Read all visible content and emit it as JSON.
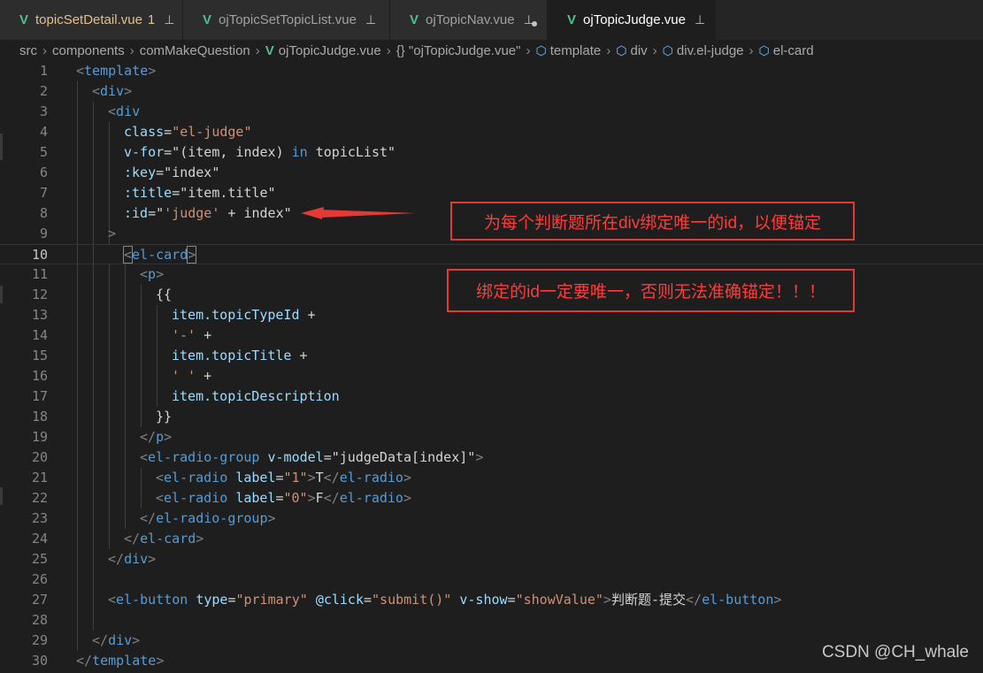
{
  "tabs": [
    {
      "title": "topicSetDetail.vue",
      "badge": "1",
      "modified": true
    },
    {
      "title": "ojTopicSetTopicList.vue"
    },
    {
      "title": "ojTopicNav.vue",
      "unsaved": true
    },
    {
      "title": "ojTopicJudge.vue",
      "active": true
    }
  ],
  "breadcrumb": [
    "src",
    "components",
    "comMakeQuestion",
    "ojTopicJudge.vue",
    "{} \"ojTopicJudge.vue\"",
    "template",
    "div",
    "div.el-judge",
    "el-card"
  ],
  "line_numbers": [
    "1",
    "2",
    "3",
    "4",
    "5",
    "6",
    "7",
    "8",
    "9",
    "10",
    "11",
    "12",
    "13",
    "14",
    "15",
    "16",
    "17",
    "18",
    "19",
    "20",
    "21",
    "22",
    "23",
    "24",
    "25",
    "26",
    "27",
    "28",
    "29",
    "30"
  ],
  "code": {
    "l1": [
      "<",
      "template",
      ">"
    ],
    "l2": [
      "<",
      "div",
      ">"
    ],
    "l3": [
      "<",
      "div"
    ],
    "l4": [
      "class",
      "=",
      "\"el-judge\""
    ],
    "l5": [
      "v-for",
      "=\"(item, index) ",
      "in",
      " topicList\""
    ],
    "l6": [
      ":key",
      "=\"index\""
    ],
    "l7": [
      ":title",
      "=\"item.title\""
    ],
    "l8": [
      ":id",
      "=\"",
      "'judge'",
      " + index\""
    ],
    "l9": [
      ">"
    ],
    "l10": [
      "<",
      "el-card",
      ">"
    ],
    "l11": [
      "<",
      "p",
      ">"
    ],
    "l12": [
      "{{"
    ],
    "l13": [
      "item.topicTypeId",
      " +"
    ],
    "l14": [
      "'-'",
      " +"
    ],
    "l15": [
      "item.topicTitle",
      " +"
    ],
    "l16": [
      "' '",
      " +"
    ],
    "l17": [
      "item.topicDescription"
    ],
    "l18": [
      "}}"
    ],
    "l19": [
      "</",
      "p",
      ">"
    ],
    "l20": [
      "<",
      "el-radio-group",
      " ",
      "v-model",
      "=\"judgeData[index]\"",
      ">"
    ],
    "l21": [
      "<",
      "el-radio",
      " ",
      "label",
      "=",
      "\"1\"",
      ">",
      "T",
      "</",
      "el-radio",
      ">"
    ],
    "l22": [
      "<",
      "el-radio",
      " ",
      "label",
      "=",
      "\"0\"",
      ">",
      "F",
      "</",
      "el-radio",
      ">"
    ],
    "l23": [
      "</",
      "el-radio-group",
      ">"
    ],
    "l24": [
      "</",
      "el-card",
      ">"
    ],
    "l25": [
      "</",
      "div",
      ">"
    ],
    "l27": [
      "<",
      "el-button",
      " ",
      "type",
      "=",
      "\"primary\"",
      " ",
      "@click",
      "=",
      "\"submit()\"",
      " ",
      "v-show",
      "=",
      "\"showValue\"",
      ">",
      "判断题-提交",
      "</",
      "el-button",
      ">"
    ],
    "l29": [
      "</",
      "div",
      ">"
    ],
    "l30": [
      "</",
      "template",
      ">"
    ]
  },
  "annotations": {
    "note1": "为每个判断题所在div绑定唯一的id，以便锚定",
    "note2": "绑定的id一定要唯一，否则无法准确锚定！！！"
  },
  "watermark": "CSDN @CH_whale",
  "colors": {
    "annotation": "#e53935",
    "vue_icon": "#4fc08d",
    "tag": "#569cd6",
    "attr": "#9cdcfe",
    "string": "#ce9178"
  }
}
